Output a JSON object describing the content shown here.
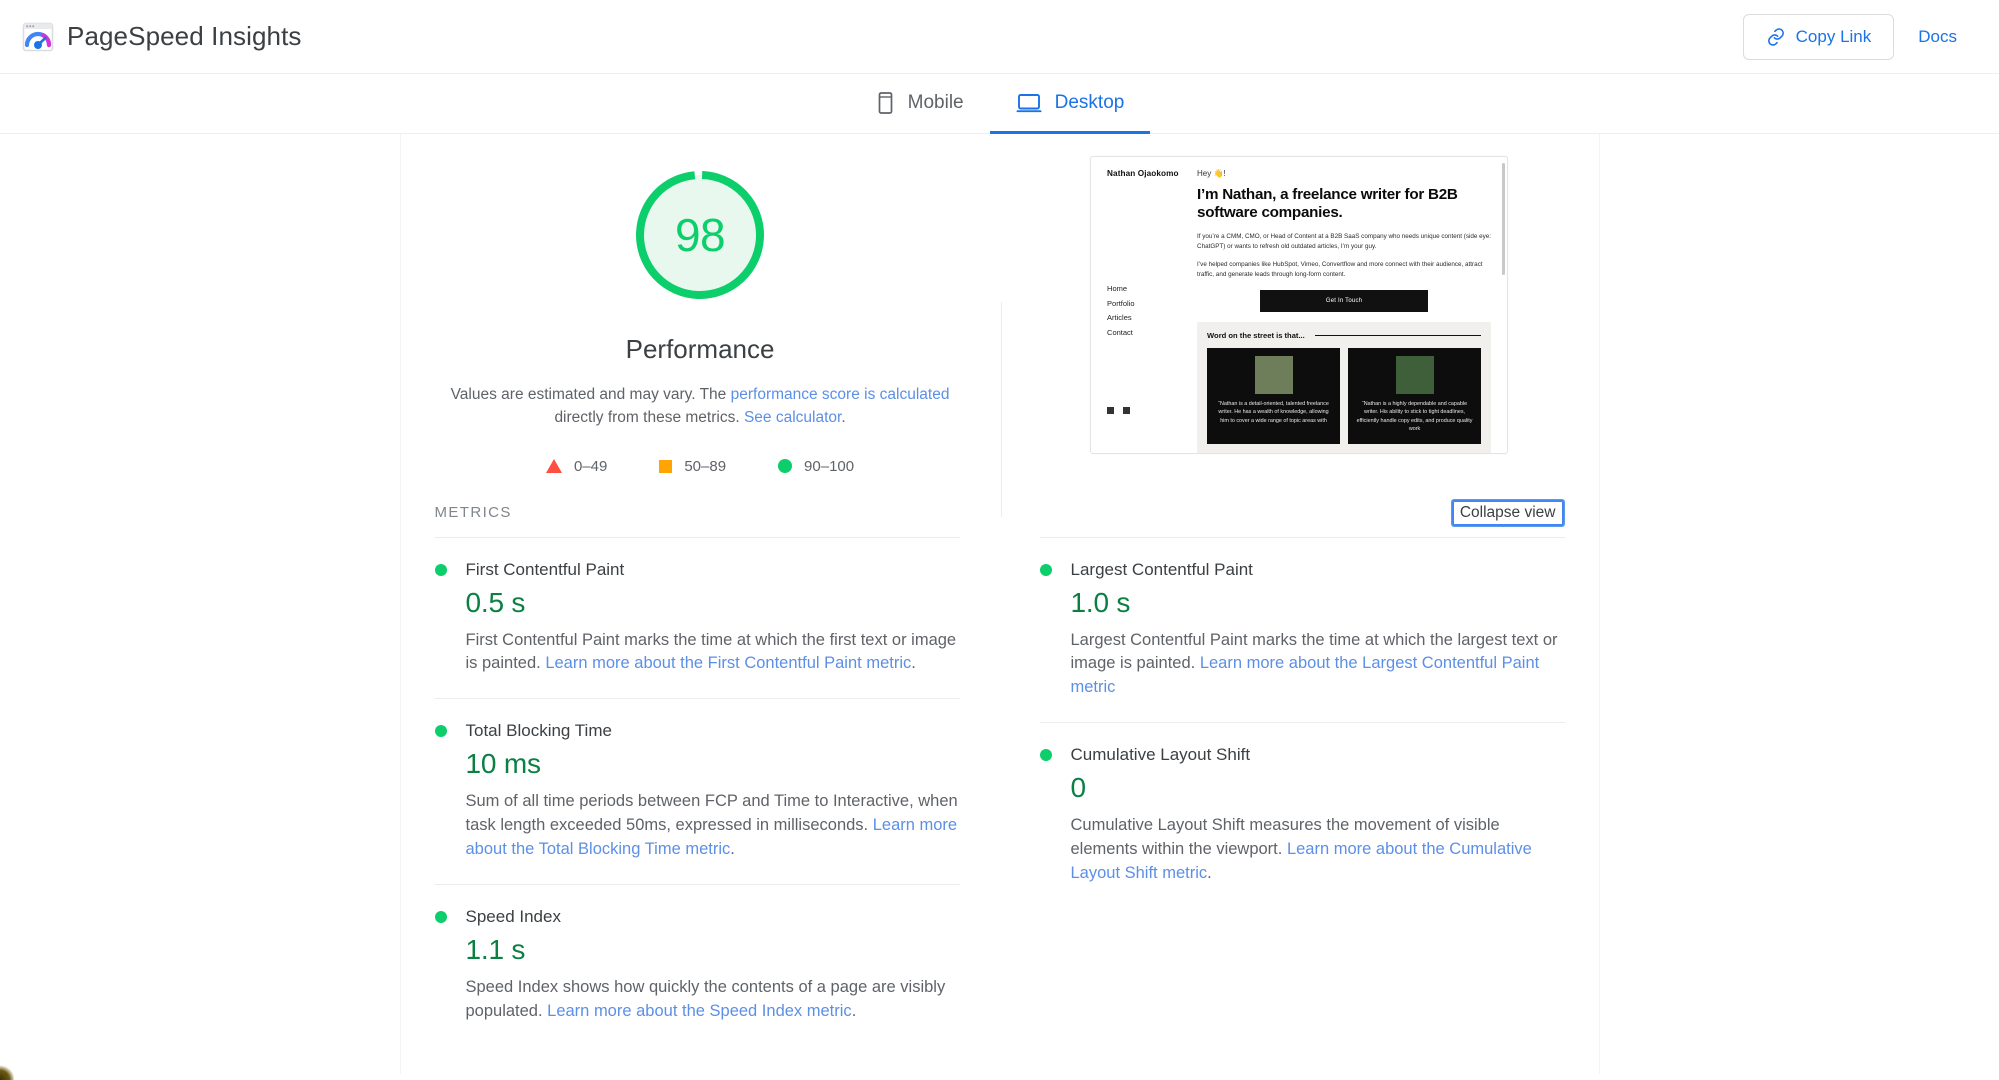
{
  "header": {
    "brand_title": "PageSpeed Insights",
    "logo_icon": "pagespeed-logo-icon",
    "copy_link_label": "Copy Link",
    "copy_link_icon": "link-icon",
    "docs_label": "Docs"
  },
  "tabs": [
    {
      "label": "Mobile",
      "icon": "phone-icon",
      "active": false
    },
    {
      "label": "Desktop",
      "icon": "monitor-icon",
      "active": true
    }
  ],
  "summary": {
    "score": "98",
    "category_label": "Performance",
    "note_prefix": "Values are estimated and may vary. The ",
    "note_link_1": "performance score is calculated",
    "note_middle": " directly from these metrics. ",
    "note_link_2": "See calculator",
    "note_suffix": ".",
    "legend": [
      {
        "shape": "triangle",
        "range": "0–49",
        "color": "#ff4e42"
      },
      {
        "shape": "square",
        "range": "50–89",
        "color": "#ffa400"
      },
      {
        "shape": "circle",
        "range": "90–100",
        "color": "#0cce6b"
      }
    ]
  },
  "screenshot_preview": {
    "site_name": "Nathan Ojaokomo",
    "greeting": "Hey 👋!",
    "headline": "I’m Nathan, a freelance writer for B2B software companies.",
    "paragraph_1": "If you’re a CMM, CMO, or Head of Content at a B2B SaaS company who needs unique content (side eye: ChatGPT) or wants to refresh old outdated articles, I’m your guy.",
    "paragraph_2": "I’ve helped companies like HubSpot, Vimeo, Convertflow and more connect with their audience, attract traffic, and generate leads through long-form content.",
    "cta_label": "Get In Touch",
    "nav": [
      "Home",
      "Portfolio",
      "Articles",
      "Contact"
    ],
    "testimonial_title": "Word on the street is that...",
    "testimonials": [
      "“Nathan is a detail-oriented, talented freelance writer. He has a wealth of knowledge, allowing him to cover a wide range of topic areas with",
      "“Nathan is a highly dependable and capable writer. His ability to stick to tight deadlines, efficiently handle copy edits, and produce quality work"
    ]
  },
  "metrics_section": {
    "label": "METRICS",
    "collapse_label": "Collapse view"
  },
  "metrics": {
    "left": [
      {
        "title": "First Contentful Paint",
        "value": "0.5 s",
        "status": "good",
        "desc_text": "First Contentful Paint marks the time at which the first text or image is painted. ",
        "desc_link": "Learn more about the First Contentful Paint metric",
        "desc_suffix": "."
      },
      {
        "title": "Total Blocking Time",
        "value": "10 ms",
        "status": "good",
        "desc_text": "Sum of all time periods between FCP and Time to Interactive, when task length exceeded 50ms, expressed in milliseconds. ",
        "desc_link": "Learn more about the Total Blocking Time metric",
        "desc_suffix": "."
      },
      {
        "title": "Speed Index",
        "value": "1.1 s",
        "status": "good",
        "desc_text": "Speed Index shows how quickly the contents of a page are visibly populated. ",
        "desc_link": "Learn more about the Speed Index metric",
        "desc_suffix": "."
      }
    ],
    "right": [
      {
        "title": "Largest Contentful Paint",
        "value": "1.0 s",
        "status": "good",
        "desc_text": "Largest Contentful Paint marks the time at which the largest text or image is painted. ",
        "desc_link": "Learn more about the Largest Contentful Paint metric",
        "desc_suffix": ""
      },
      {
        "title": "Cumulative Layout Shift",
        "value": "0",
        "status": "good",
        "desc_text": "Cumulative Layout Shift measures the movement of visible elements within the viewport. ",
        "desc_link": "Learn more about the Cumulative Layout Shift metric",
        "desc_suffix": "."
      }
    ]
  },
  "colors": {
    "good_green": "#0cce6b",
    "value_green": "#0b8043",
    "average_orange": "#ffa400",
    "poor_red": "#ff4e42",
    "link_blue": "#1a73e8",
    "body_link_blue": "#5c8fe6",
    "text_primary": "#3c4043",
    "text_secondary": "#5f6368"
  }
}
